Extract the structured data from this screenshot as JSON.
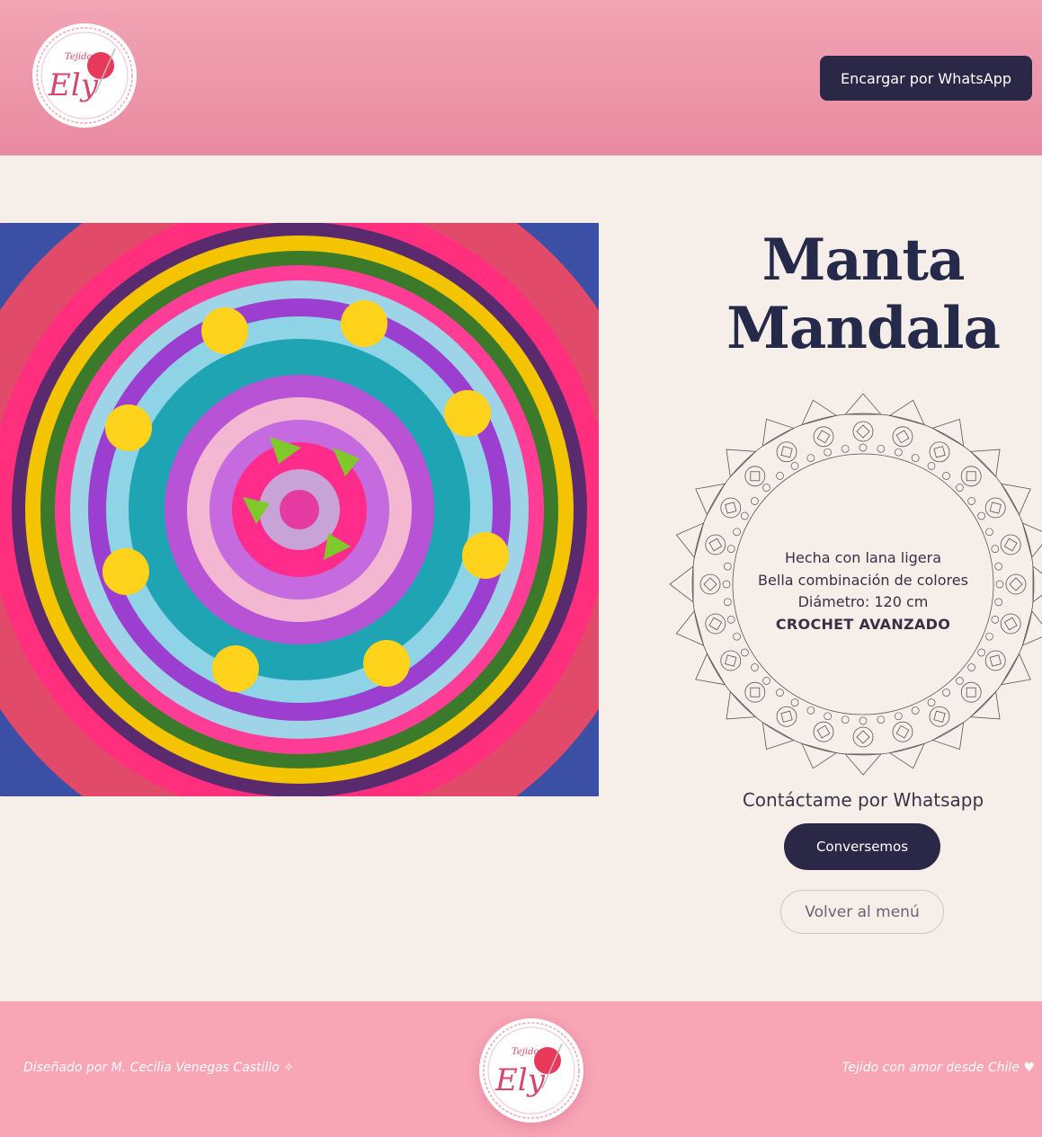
{
  "header": {
    "whatsapp_button": "Encargar por WhatsApp"
  },
  "logo": {
    "small_text": "Tejidos",
    "main_text": "Ely"
  },
  "product": {
    "title_line1": "Manta",
    "title_line2": "Mandala",
    "features": [
      "Hecha con lana ligera",
      "Bella combinación de colores",
      "Diámetro: 120 cm",
      "CROCHET AVANZADO"
    ],
    "contact_label": "Contáctame por Whatsapp",
    "chat_button": "Conversemos",
    "back_button": "Volver al menú"
  },
  "footer": {
    "left_text": "Diseñado por M. Cecilia Venegas Castillo ✧",
    "right_text": "Tejido con amor desde Chile ♥"
  },
  "colors": {
    "header_pink": "#f2a5b4",
    "footer_pink": "#f8a5b6",
    "navy": "#2b2847",
    "cream": "#f6efe9",
    "logo_red": "#e8395a"
  }
}
